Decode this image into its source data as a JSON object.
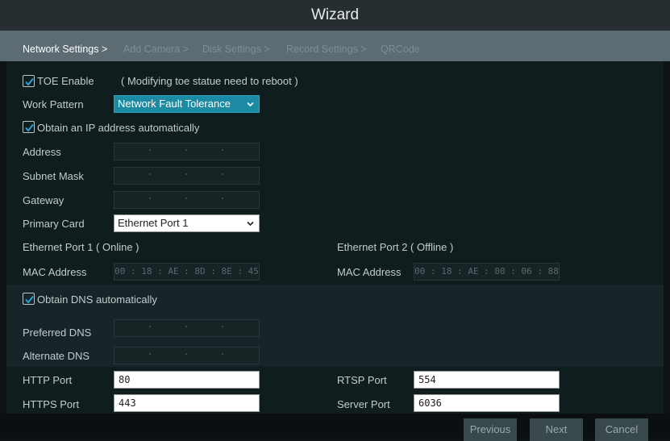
{
  "window": {
    "title": "Wizard"
  },
  "steps": [
    "Network Settings >",
    "Add Camera >",
    "Disk Settings >",
    "Record Settings >",
    "QRCode"
  ],
  "toe": {
    "label": "TOE Enable",
    "note": "( Modifying toe statue need to reboot )",
    "checked": true
  },
  "work_pattern": {
    "label": "Work Pattern",
    "value": "Network Fault Tolerance"
  },
  "obtain_ip": {
    "label": "Obtain an IP address automatically",
    "checked": true
  },
  "address": {
    "label": "Address"
  },
  "subnet_mask": {
    "label": "Subnet Mask"
  },
  "gateway": {
    "label": "Gateway"
  },
  "primary_card": {
    "label": "Primary Card",
    "value": "Ethernet Port 1"
  },
  "port1": {
    "title": "Ethernet Port 1 ( Online )",
    "mac_label": "MAC Address",
    "mac": "00 : 18 : AE : 8D : 8E : 45"
  },
  "port2": {
    "title": "Ethernet Port 2 ( Offline )",
    "mac_label": "MAC Address",
    "mac": "00 : 18 : AE : 00 : 06 : 88"
  },
  "obtain_dns": {
    "label": "Obtain DNS automatically",
    "checked": true
  },
  "preferred_dns": {
    "label": "Preferred DNS"
  },
  "alternate_dns": {
    "label": "Alternate DNS"
  },
  "http_port": {
    "label": "HTTP Port",
    "value": "80"
  },
  "https_port": {
    "label": "HTTPS Port",
    "value": "443"
  },
  "rtsp_port": {
    "label": "RTSP Port",
    "value": "554"
  },
  "server_port": {
    "label": "Server Port",
    "value": "6036"
  },
  "buttons": {
    "previous": "Previous",
    "next": "Next",
    "cancel": "Cancel"
  },
  "colors": {
    "accent": "#1c8aa3",
    "checkmark": "#29a3d6",
    "title_bar": "#262e31",
    "step_bar": "#5c6c72",
    "background": "#0f1d1f"
  }
}
